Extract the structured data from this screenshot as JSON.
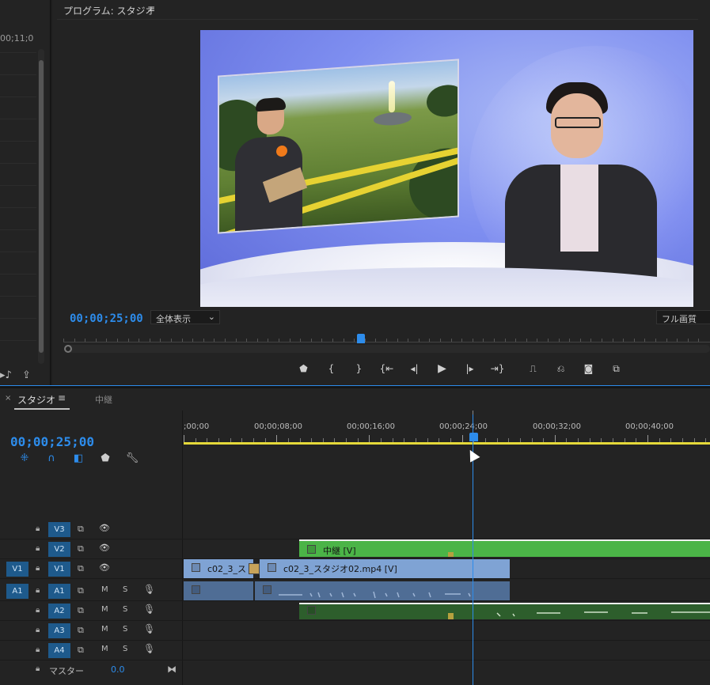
{
  "left_panel": {
    "timecode": "00;11;0"
  },
  "program": {
    "title": "プログラム: スタジオ",
    "menu_icon": "≡",
    "timecode": "00;00;25;00",
    "fit": "全体表示",
    "quality": "フル画質",
    "playhead_fraction": 0.46,
    "transport": {
      "marker": "add-marker",
      "in": "{",
      "out": "}",
      "go_in": "go-to-in",
      "step_back": "step-back",
      "play": "play",
      "step_forward": "step-forward",
      "go_out": "go-to-out",
      "lift": "lift",
      "extract": "extract",
      "export_frame": "export-frame",
      "compare": "compare-view"
    }
  },
  "timeline": {
    "tab_close": "×",
    "tab_name": "スタジオ",
    "tab_menu": "≡",
    "tab_other": "中継",
    "timecode": "00;00;25;00",
    "ruler_labels": [
      ";00;00",
      "00;00;08;00",
      "00;00;16;00",
      "00;00;24;00",
      "00;00;32;00",
      "00;00;40;00"
    ],
    "tools": [
      "snap",
      "link",
      "insert",
      "marker",
      "settings"
    ],
    "tracks_video": [
      {
        "id": "V3",
        "source": ""
      },
      {
        "id": "V2",
        "source": ""
      },
      {
        "id": "V1",
        "source": "V1"
      }
    ],
    "tracks_audio": [
      {
        "id": "A1",
        "source": "A1"
      },
      {
        "id": "A2",
        "source": ""
      },
      {
        "id": "A3",
        "source": ""
      },
      {
        "id": "A4",
        "source": ""
      }
    ],
    "m_label": "M",
    "s_label": "S",
    "master_label": "マスター",
    "master_value": "0.0",
    "clips": {
      "v2": "中継 [V]",
      "v1a": "c02_3_ス",
      "v1b": "c02_3_スタジオ02.mp4 [V]"
    },
    "colors": {
      "accent": "#2d8ceb",
      "video_clip": "#7fa3d4",
      "green_clip": "#4bb447",
      "workarea": "#e5d93a"
    }
  }
}
